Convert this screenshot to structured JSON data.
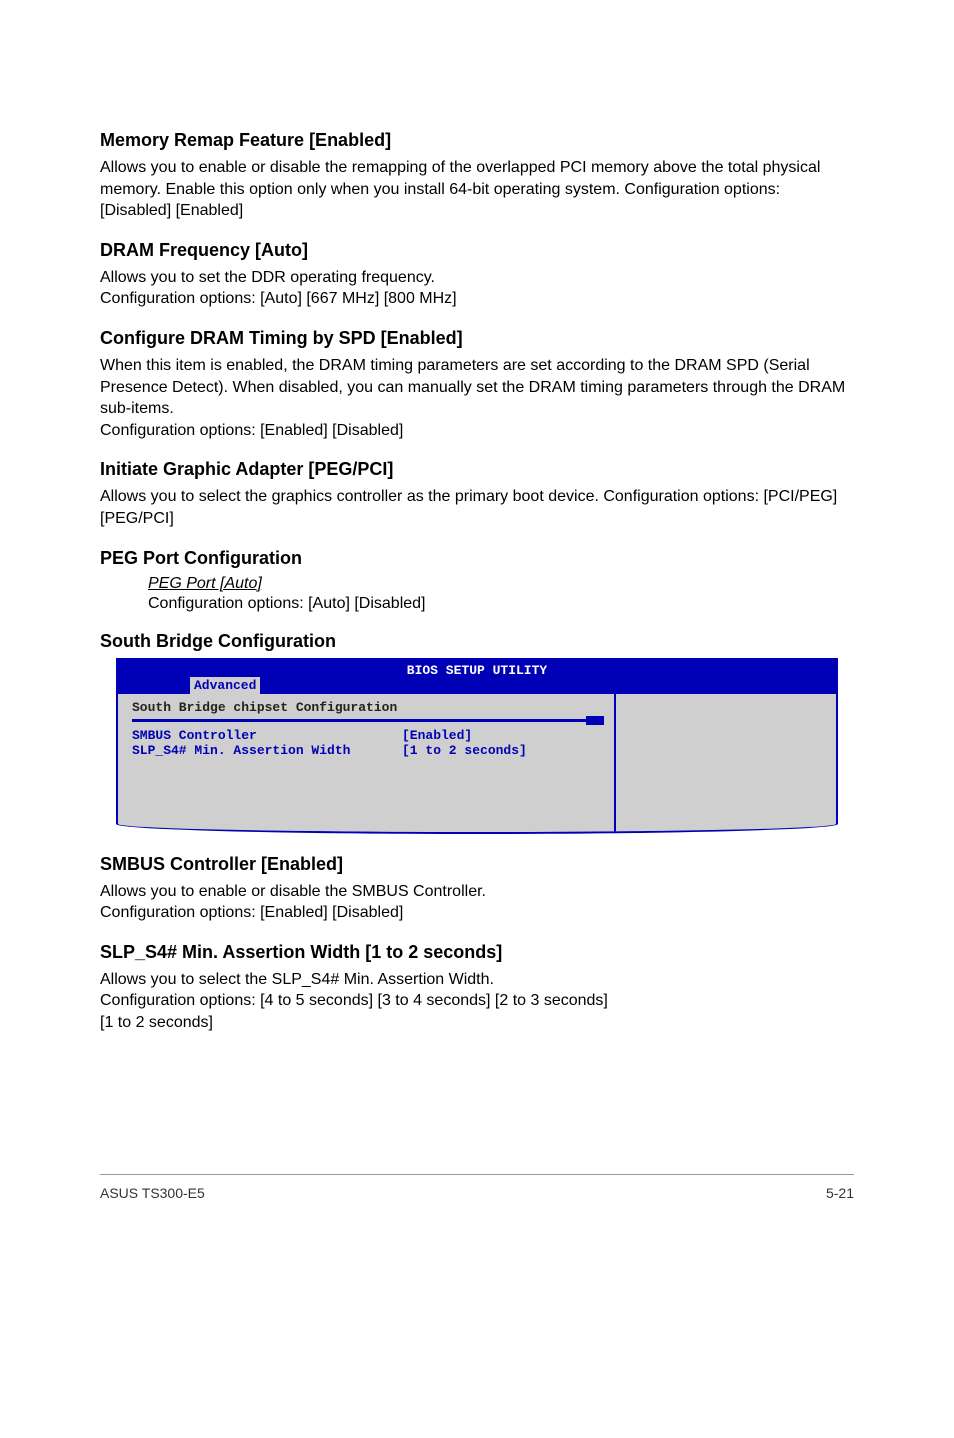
{
  "sections": {
    "memory_remap": {
      "title": "Memory Remap Feature [Enabled]",
      "body": "Allows you to enable or disable the remapping of the overlapped PCI memory above the total physical memory. Enable this option only when you install 64-bit operating system. Configuration options: [Disabled] [Enabled]"
    },
    "dram_freq": {
      "title": "DRAM Frequency [Auto]",
      "body": "Allows you to set the DDR operating frequency.\nConfiguration options: [Auto] [667 MHz] [800 MHz]"
    },
    "dram_timing": {
      "title": "Configure DRAM Timing by SPD [Enabled]",
      "body": "When this item is enabled, the DRAM timing parameters are set according to the DRAM SPD (Serial Presence Detect). When disabled, you can manually set the DRAM timing parameters through the DRAM sub-items.\nConfiguration options: [Enabled] [Disabled]"
    },
    "initiate_graphic": {
      "title": "Initiate Graphic Adapter [PEG/PCI]",
      "body": "Allows you to select the graphics controller as the primary boot device. Configuration options: [PCI/PEG] [PEG/PCI]"
    },
    "peg_port": {
      "title": "PEG Port Configuration",
      "sub_title": "PEG Port [Auto]",
      "sub_body": "Configuration options: [Auto] [Disabled]"
    },
    "south_bridge": {
      "title": "South Bridge Configuration"
    },
    "smbus": {
      "title": "SMBUS Controller [Enabled]",
      "body": "Allows you to enable or disable the SMBUS Controller.\nConfiguration options: [Enabled] [Disabled]"
    },
    "slp_s4": {
      "title": "SLP_S4# Min. Assertion Width [1 to 2 seconds]",
      "body": "Allows you to select the SLP_S4# Min. Assertion Width.\nConfiguration options: [4 to 5 seconds] [3 to 4 seconds] [2 to 3 seconds]\n[1 to 2 seconds]"
    }
  },
  "bios": {
    "utility_title": "BIOS SETUP UTILITY",
    "tab": "Advanced",
    "panel_title": "South Bridge chipset Configuration",
    "rows": [
      {
        "label": "SMBUS Controller",
        "value": "[Enabled]"
      },
      {
        "label": "SLP_S4# Min. Assertion Width",
        "value": "[1 to 2 seconds]"
      }
    ]
  },
  "footer": {
    "left": "ASUS TS300-E5",
    "right": "5-21"
  }
}
